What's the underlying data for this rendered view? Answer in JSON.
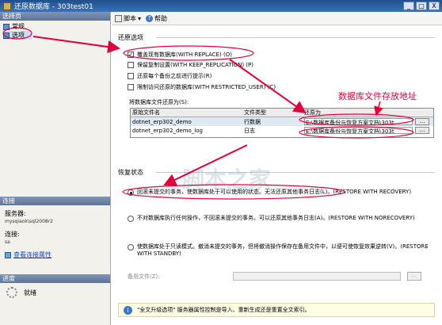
{
  "window": {
    "title": "还原数据库 - 303test01",
    "buttons": [
      "_",
      "□",
      "X"
    ]
  },
  "left": {
    "select_page_header": "选择页",
    "pages": [
      {
        "label": "常规"
      },
      {
        "label": "选项"
      }
    ],
    "connection_header": "连接",
    "server_label": "服务器:",
    "server_value": "mysqiaok\\sql2008r2",
    "conn_label": "连接:",
    "conn_value": "sa",
    "view_conn_props": "查看连接属性",
    "progress_header": "进度",
    "progress_status": "就绪"
  },
  "toolbar": {
    "script": "脚本",
    "help": "帮助"
  },
  "restore_options": {
    "title": "还原选项",
    "checks": [
      {
        "label": "覆盖现有数据库(WITH REPLACE) (O)",
        "checked": true
      },
      {
        "label": "保留复制设置(WITH KEEP_REPLICATION) (P)",
        "checked": false
      },
      {
        "label": "还原每个备份之前进行提示(R)",
        "checked": false
      },
      {
        "label": "限制访问还原的数据库(WITH RESTRICTED_USER) (C)",
        "checked": false
      }
    ],
    "restore_as_label": "将数据库文件还原为(S):",
    "table": {
      "headers": [
        "原始文件名",
        "文件类型",
        "还原为"
      ],
      "rows": [
        [
          "dotnet_erp302_demo",
          "行数据",
          "E:\\数据库备份与恢复方案文档\\303t",
          "..."
        ],
        [
          "dotnet_erp302_demo_log",
          "日志",
          "E:\\数据库备份与恢复方案文档\\303t",
          "..."
        ]
      ]
    }
  },
  "annotation": "数据库文件存放地址",
  "recovery": {
    "title": "恢复状态",
    "options": [
      {
        "label": "回滚未提交的事务，使数据库处于可以使用的状态。无法还原其他事务日志(L)。(RESTORE WITH RECOVERY)",
        "selected": true
      },
      {
        "label": "不对数据库执行任何操作，不回滚未提交的事务。可以还原其他事务日志(A)。(RESTORE WITH NORECOVERY)",
        "selected": false
      },
      {
        "label": "使数据库处于只读模式。撤消未提交的事务，但将撤消操作保存在备用文件中，以便可使恢复效果逆转(V)。(RESTORE WITH STANDBY)",
        "selected": false
      }
    ],
    "standby_label": "备用文件(Z):",
    "standby_button": "..."
  },
  "info": {
    "text": "\"全文升级选项\" 服务器属性控制是导入、重新生成还是重置全文索引。"
  },
  "watermark": {
    "main": "脚本之家",
    "sub": "www.jb51.net"
  },
  "colors": {
    "annotation": "#e0003c",
    "title_bar": "#2d5fa0"
  }
}
